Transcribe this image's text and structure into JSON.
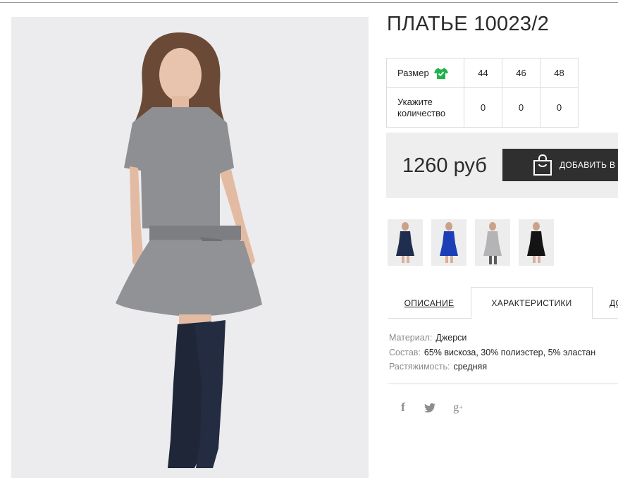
{
  "product": {
    "title": "ПЛАТЬЕ 10023/2",
    "price": "1260 руб",
    "add_button_label": "ДОБАВИТЬ В"
  },
  "size_table": {
    "size_label": "Размер",
    "quantity_label": "Укажите количество",
    "sizes": [
      "44",
      "46",
      "48"
    ],
    "quantities": [
      "0",
      "0",
      "0"
    ]
  },
  "thumbnails": [
    {
      "color": "#1f2d4f"
    },
    {
      "color": "#1c3fb5"
    },
    {
      "color": "#b4b4b6"
    },
    {
      "color": "#141414"
    }
  ],
  "tabs": {
    "description": "ОПИСАНИЕ",
    "characteristics": "ХАРАКТЕРИСТИКИ",
    "more": "ДО"
  },
  "specs": [
    {
      "key": "Материал:",
      "value": "Джерси"
    },
    {
      "key": "Состав:",
      "value": "65% вискоза, 30% полиэстер, 5% эластан"
    },
    {
      "key": "Растяжимость:",
      "value": "средняя"
    }
  ],
  "social": {
    "facebook": "f",
    "google_plus": "g"
  },
  "colors": {
    "button_bg": "#2f2f2f",
    "price_bg": "#eeeeee",
    "check_green": "#22b24c",
    "dress_gray": "#8e8f93",
    "boots_navy": "#1e2638"
  }
}
